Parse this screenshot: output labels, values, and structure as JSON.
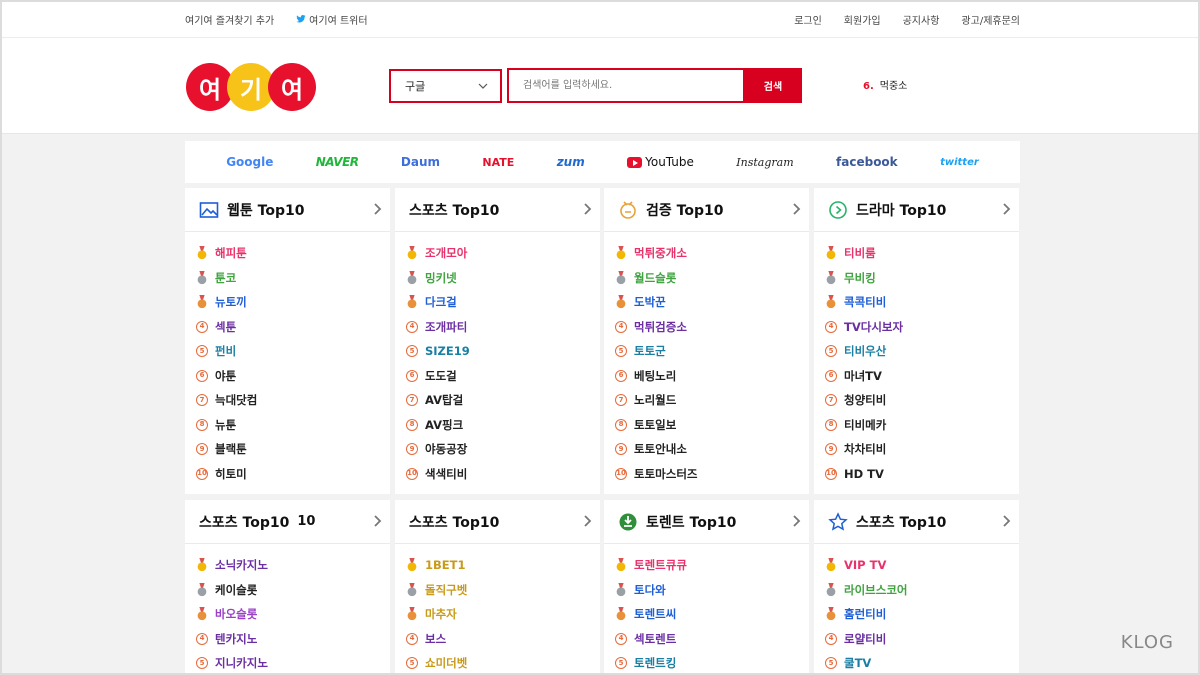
{
  "topbar": {
    "bookmark": "여기여 즐겨찾기 추가",
    "twitter": "여기여 트위터",
    "links": [
      "로그인",
      "회원가입",
      "공지사항",
      "광고/제휴문의"
    ]
  },
  "logo": {
    "chars": [
      "여",
      "기",
      "여"
    ]
  },
  "search": {
    "engine": "구글",
    "placeholder": "검색어를 입력하세요.",
    "button": "검색"
  },
  "trending": {
    "rank": "6.",
    "term": "먹중소"
  },
  "portals": [
    "Google",
    "NAVER",
    "Daum",
    "NATE",
    "zum",
    "YouTube",
    "Instagram",
    "facebook",
    "twitter"
  ],
  "colors": {
    "accent": "#d7001f",
    "logo_red": "#e8112d",
    "logo_yellow": "#f7c319"
  },
  "cards": [
    {
      "title": "웹툰 Top10",
      "extra": "",
      "icon": "image-icon",
      "items": [
        {
          "rank": "1",
          "name": "해피툰",
          "color": "#e8326b"
        },
        {
          "rank": "2",
          "name": "툰코",
          "color": "#3fa33f"
        },
        {
          "rank": "3",
          "name": "뉴토끼",
          "color": "#1f5fd6"
        },
        {
          "rank": "4",
          "name": "섹툰",
          "color": "#6b2fa3"
        },
        {
          "rank": "5",
          "name": "펀비",
          "color": "#1a7fa3"
        },
        {
          "rank": "6",
          "name": "야툰",
          "color": "#222222"
        },
        {
          "rank": "7",
          "name": "늑대닷컴",
          "color": "#222222"
        },
        {
          "rank": "8",
          "name": "뉴툰",
          "color": "#222222"
        },
        {
          "rank": "9",
          "name": "블랙툰",
          "color": "#222222"
        },
        {
          "rank": "10",
          "name": "히토미",
          "color": "#222222"
        }
      ]
    },
    {
      "title": "스포츠 Top10",
      "extra": "",
      "icon": "",
      "items": [
        {
          "rank": "1",
          "name": "조개모아",
          "color": "#e8326b"
        },
        {
          "rank": "2",
          "name": "밍키넷",
          "color": "#3fa33f"
        },
        {
          "rank": "3",
          "name": "다크걸",
          "color": "#1f5fd6"
        },
        {
          "rank": "4",
          "name": "조개파티",
          "color": "#6b2fa3"
        },
        {
          "rank": "5",
          "name": "SIZE19",
          "color": "#1a7fa3"
        },
        {
          "rank": "6",
          "name": "도도걸",
          "color": "#222222"
        },
        {
          "rank": "7",
          "name": "AV탑걸",
          "color": "#222222"
        },
        {
          "rank": "8",
          "name": "AV핑크",
          "color": "#222222"
        },
        {
          "rank": "9",
          "name": "야동공장",
          "color": "#222222"
        },
        {
          "rank": "10",
          "name": "색색티비",
          "color": "#222222"
        }
      ]
    },
    {
      "title": "검증 Top10",
      "extra": "",
      "icon": "verify-icon",
      "items": [
        {
          "rank": "1",
          "name": "먹튀중개소",
          "color": "#e8326b"
        },
        {
          "rank": "2",
          "name": "월드슬롯",
          "color": "#3fa33f"
        },
        {
          "rank": "3",
          "name": "도박꾼",
          "color": "#1f5fd6"
        },
        {
          "rank": "4",
          "name": "먹튀검증소",
          "color": "#6b2fa3"
        },
        {
          "rank": "5",
          "name": "토토군",
          "color": "#1a7fa3"
        },
        {
          "rank": "6",
          "name": "베팅노리",
          "color": "#222222"
        },
        {
          "rank": "7",
          "name": "노리월드",
          "color": "#222222"
        },
        {
          "rank": "8",
          "name": "토토일보",
          "color": "#222222"
        },
        {
          "rank": "9",
          "name": "토토안내소",
          "color": "#222222"
        },
        {
          "rank": "10",
          "name": "토토마스터즈",
          "color": "#222222"
        }
      ]
    },
    {
      "title": "드라마 Top10",
      "extra": "",
      "icon": "play-circle-icon",
      "items": [
        {
          "rank": "1",
          "name": "티비룸",
          "color": "#e8326b"
        },
        {
          "rank": "2",
          "name": "무비킹",
          "color": "#3fa33f"
        },
        {
          "rank": "3",
          "name": "콕콕티비",
          "color": "#1f5fd6"
        },
        {
          "rank": "4",
          "name": "TV다시보자",
          "color": "#6b2fa3"
        },
        {
          "rank": "5",
          "name": "티비우산",
          "color": "#1a7fa3"
        },
        {
          "rank": "6",
          "name": "마녀TV",
          "color": "#222222"
        },
        {
          "rank": "7",
          "name": "청양티비",
          "color": "#222222"
        },
        {
          "rank": "8",
          "name": "티비메카",
          "color": "#222222"
        },
        {
          "rank": "9",
          "name": "차차티비",
          "color": "#222222"
        },
        {
          "rank": "10",
          "name": "HD TV",
          "color": "#222222"
        }
      ]
    },
    {
      "title": "스포츠 Top10",
      "extra": "10",
      "icon": "",
      "items": [
        {
          "rank": "1",
          "name": "소닉카지노",
          "color": "#6b2fa3"
        },
        {
          "rank": "2",
          "name": "케이슬롯",
          "color": "#222222"
        },
        {
          "rank": "3",
          "name": "바오슬롯",
          "color": "#9a3fc7"
        },
        {
          "rank": "4",
          "name": "텐카지노",
          "color": "#6b2fa3"
        },
        {
          "rank": "5",
          "name": "지니카지노",
          "color": "#6b2fa3"
        }
      ]
    },
    {
      "title": "스포츠 Top10",
      "extra": "",
      "icon": "",
      "items": [
        {
          "rank": "1",
          "name": "1BET1",
          "color": "#c99a1a"
        },
        {
          "rank": "2",
          "name": "돌직구벳",
          "color": "#c99a1a"
        },
        {
          "rank": "3",
          "name": "마추자",
          "color": "#c99a1a"
        },
        {
          "rank": "4",
          "name": "보스",
          "color": "#6b2fa3"
        },
        {
          "rank": "5",
          "name": "쇼미더벳",
          "color": "#c99a1a"
        }
      ]
    },
    {
      "title": "토렌트 Top10",
      "extra": "",
      "icon": "torrent-icon",
      "items": [
        {
          "rank": "1",
          "name": "토렌트큐큐",
          "color": "#e8326b"
        },
        {
          "rank": "2",
          "name": "토다와",
          "color": "#1f5fd6"
        },
        {
          "rank": "3",
          "name": "토렌트씨",
          "color": "#1f5fd6"
        },
        {
          "rank": "4",
          "name": "섹토렌트",
          "color": "#6b2fa3"
        },
        {
          "rank": "5",
          "name": "토렌트킹",
          "color": "#1a7fa3"
        }
      ]
    },
    {
      "title": "스포츠 Top10",
      "extra": "",
      "icon": "star-icon",
      "items": [
        {
          "rank": "1",
          "name": "VIP TV",
          "color": "#e8326b"
        },
        {
          "rank": "2",
          "name": "라이브스코어",
          "color": "#3fa33f"
        },
        {
          "rank": "3",
          "name": "홈런티비",
          "color": "#1f5fd6"
        },
        {
          "rank": "4",
          "name": "로얄티비",
          "color": "#6b2fa3"
        },
        {
          "rank": "5",
          "name": "쿨TV",
          "color": "#1a7fa3"
        }
      ]
    }
  ],
  "watermark": "KLOG"
}
